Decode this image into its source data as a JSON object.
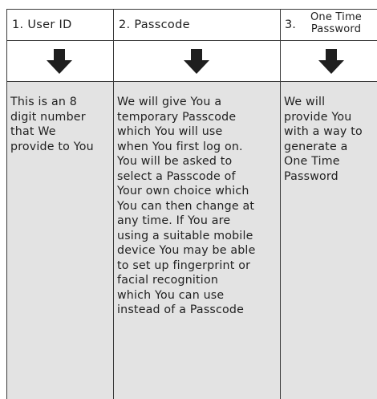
{
  "columns": [
    {
      "number": "1.",
      "title": "User ID",
      "arrow": "down-arrow-icon",
      "body": "This is an 8\ndigit number\nthat We\nprovide to You"
    },
    {
      "number": "2.",
      "title": "Passcode",
      "arrow": "down-arrow-icon",
      "body": "We will give You a\ntemporary Passcode\nwhich You will use\nwhen You first log on.\nYou will be asked to\nselect a Passcode of\nYour own choice which\nYou can then change at\nany time. If You are\nusing a suitable mobile\ndevice You may be able\nto set up fingerprint or\nfacial recognition\nwhich You can use\ninstead of a Passcode"
    },
    {
      "number": "3.",
      "title_line1": "One Time",
      "title_line2": "Password",
      "arrow": "down-arrow-icon",
      "body": "We will\nprovide You\nwith a way to\ngenerate a\nOne Time\nPassword"
    }
  ],
  "colors": {
    "body_fill": "#e3e3e3",
    "lines": "#3a3a3a",
    "text": "#1f1f1f"
  }
}
